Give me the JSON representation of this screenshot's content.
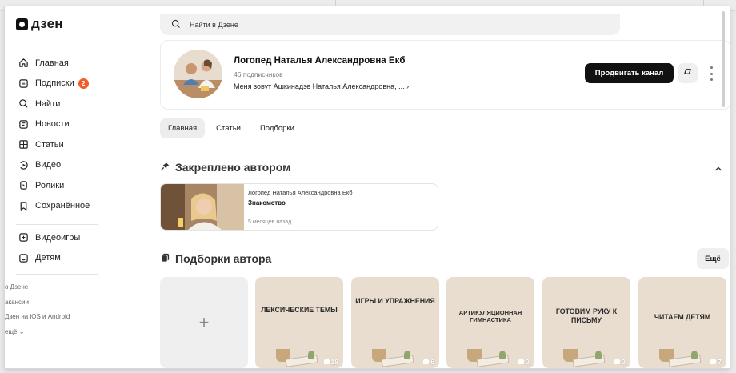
{
  "app": {
    "logo_text": "дзен"
  },
  "search": {
    "placeholder": "Найти в Дзене"
  },
  "sidebar": {
    "items": [
      {
        "label": "Главная",
        "icon": "home-icon"
      },
      {
        "label": "Подписки",
        "icon": "subscriptions-icon",
        "badge": "2"
      },
      {
        "label": "Найти",
        "icon": "search-icon"
      },
      {
        "label": "Новости",
        "icon": "news-icon"
      },
      {
        "label": "Статьи",
        "icon": "articles-icon"
      },
      {
        "label": "Видео",
        "icon": "video-icon"
      },
      {
        "label": "Ролики",
        "icon": "shorts-icon"
      },
      {
        "label": "Сохранённое",
        "icon": "bookmark-icon"
      }
    ],
    "items2": [
      {
        "label": "Видеоигры",
        "icon": "gamepad-icon"
      },
      {
        "label": "Детям",
        "icon": "kids-icon"
      }
    ],
    "footer": [
      "о Дзене",
      "акансии",
      "Дзен на iOS и Android",
      "ещё ⌄"
    ]
  },
  "channel": {
    "name": "Логопед Наталья Александровна Екб",
    "subscribers": "46 подписчиков",
    "description": "Меня зовут Ашкинадзе Наталья Александровна, ...",
    "promote_label": "Продвигать канал"
  },
  "tabs": [
    "Главная",
    "Статьи",
    "Подборки"
  ],
  "pinned": {
    "section_title": "Закреплено автором",
    "author": "Логопед Наталья Александровна Екб",
    "title": "Знакомство",
    "time": "5 месяцев назад"
  },
  "collections": {
    "section_title": "Подборки автора",
    "more_label": "Ещё",
    "add_label": "+",
    "items": [
      {
        "title": "ЛЕКСИЧЕСКИЕ ТЕМЫ",
        "count": "18"
      },
      {
        "title": "ИГРЫ И УПРАЖНЕНИЯ",
        "count": "6"
      },
      {
        "title": "АРТИКУЛЯЦИОННАЯ ГИМНАСТИКА",
        "count": "3"
      },
      {
        "title": "ГОТОВИМ РУКУ К ПИСЬМУ",
        "count": "3"
      },
      {
        "title": "ЧИТАЕМ ДЕТЯМ",
        "count": "7"
      }
    ]
  },
  "colors": {
    "accent_badge": "#f25c2a",
    "primary_button": "#111111",
    "card_beige": "#e9ddd0"
  }
}
